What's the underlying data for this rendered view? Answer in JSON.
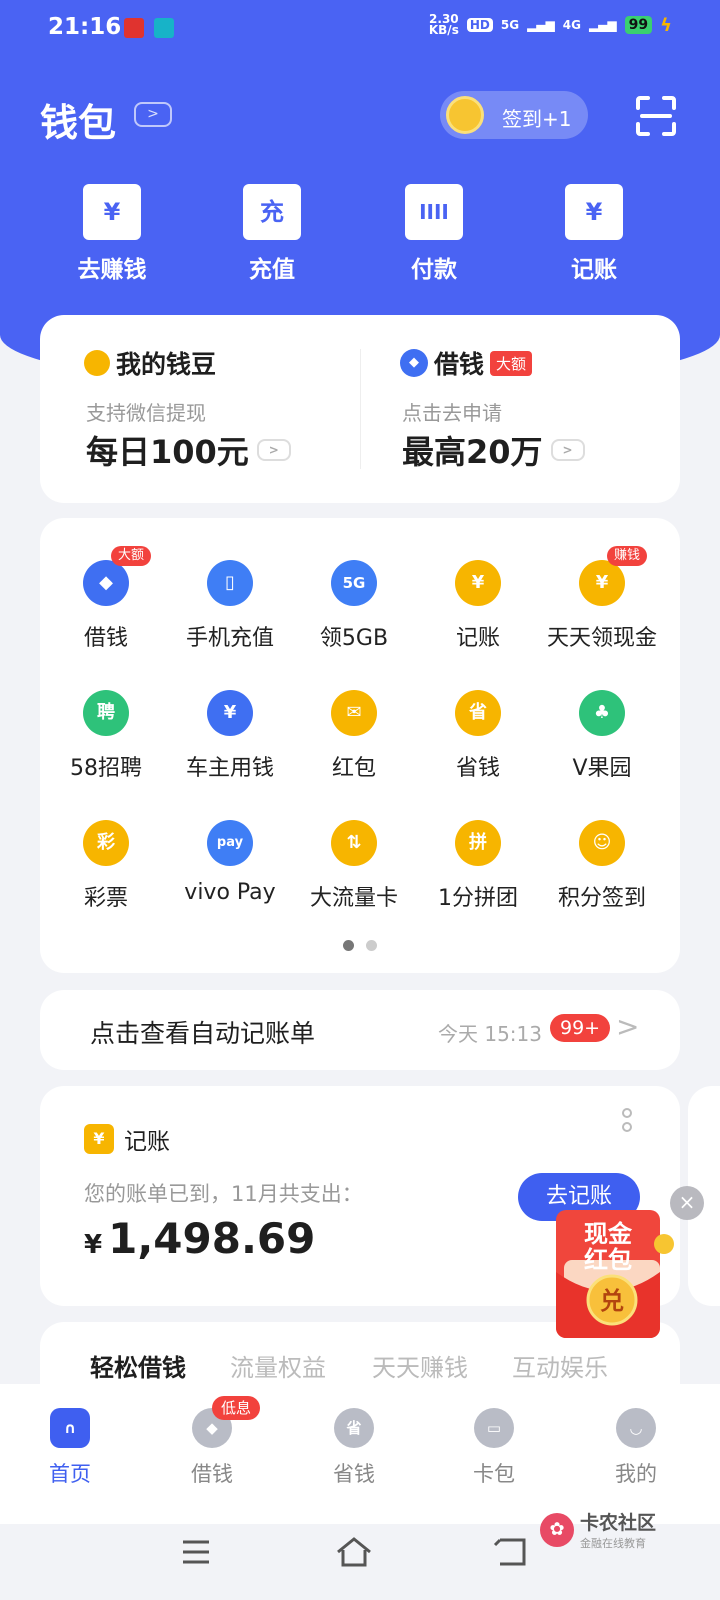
{
  "status": {
    "time": "21:16",
    "speed_top": "2.30",
    "speed_unit": "KB/s",
    "hd": "HD",
    "net1": "5G",
    "net2": "4G",
    "battery": "99"
  },
  "header": {
    "title": "钱包",
    "signin_label": "签到+1"
  },
  "top_actions": [
    {
      "label": "去赚钱",
      "icon": "yen-gift-icon",
      "glyph": "¥"
    },
    {
      "label": "充值",
      "icon": "recharge-icon",
      "glyph": "充"
    },
    {
      "label": "付款",
      "icon": "barcode-icon",
      "glyph": "IIII"
    },
    {
      "label": "记账",
      "icon": "ledger-icon",
      "glyph": "¥"
    }
  ],
  "beans": {
    "title": "我的钱豆",
    "subtitle": "支持微信提现",
    "value": "每日100元"
  },
  "loan": {
    "title": "借钱",
    "tag": "大额",
    "subtitle": "点击去申请",
    "value": "最高20万"
  },
  "grid": [
    {
      "label": "借钱",
      "glyph": "◆",
      "color": "#3f6ff2",
      "badge": "大额"
    },
    {
      "label": "手机充值",
      "glyph": "▯",
      "color": "#3f7ef5",
      "badge": ""
    },
    {
      "label": "领5GB",
      "glyph": "5G",
      "color": "#3f7ef5",
      "badge": ""
    },
    {
      "label": "记账",
      "glyph": "¥",
      "color": "#f7b500",
      "badge": ""
    },
    {
      "label": "天天领现金",
      "glyph": "¥",
      "color": "#f7b500",
      "badge": "赚钱"
    },
    {
      "label": "58招聘",
      "glyph": "聘",
      "color": "#2ec27a",
      "badge": ""
    },
    {
      "label": "车主用钱",
      "glyph": "¥",
      "color": "#3f6ff2",
      "badge": ""
    },
    {
      "label": "红包",
      "glyph": "✉",
      "color": "#f7b500",
      "badge": ""
    },
    {
      "label": "省钱",
      "glyph": "省",
      "color": "#f7b500",
      "badge": ""
    },
    {
      "label": "V果园",
      "glyph": "♣",
      "color": "#2ec27a",
      "badge": ""
    },
    {
      "label": "彩票",
      "glyph": "彩",
      "color": "#f7b500",
      "badge": ""
    },
    {
      "label": "vivo Pay",
      "glyph": "pay",
      "color": "#3f7ef5",
      "badge": ""
    },
    {
      "label": "大流量卡",
      "glyph": "⇅",
      "color": "#f7b500",
      "badge": ""
    },
    {
      "label": "1分拼团",
      "glyph": "拼",
      "color": "#f7b500",
      "badge": ""
    },
    {
      "label": "积分签到",
      "glyph": "☺",
      "color": "#f7b500",
      "badge": ""
    }
  ],
  "auto_bill": {
    "text": "点击查看自动记账单",
    "time": "今天 15:13",
    "count": "99+"
  },
  "ledger": {
    "title": "记账",
    "icon_glyph": "¥",
    "desc": "您的账单已到，11月共支出：",
    "currency": "¥",
    "amount": "1,498.69",
    "button": "去记账"
  },
  "promo": {
    "line1": "现金",
    "line2": "红包",
    "coin": "兑"
  },
  "tabs": [
    "轻松借钱",
    "流量权益",
    "天天赚钱",
    "互动娱乐"
  ],
  "nav": [
    {
      "label": "首页",
      "glyph": "∩",
      "active": true
    },
    {
      "label": "借钱",
      "glyph": "◆",
      "badge": "低息"
    },
    {
      "label": "省钱",
      "glyph": "省"
    },
    {
      "label": "卡包",
      "glyph": "▭"
    },
    {
      "label": "我的",
      "glyph": "◡"
    }
  ],
  "watermark": {
    "title": "卡农社区",
    "subtitle": "金融在线教育"
  },
  "colors": {
    "brand": "#4a63f3",
    "red": "#f2423d",
    "yellow": "#f7b500",
    "green": "#2ec27a"
  }
}
